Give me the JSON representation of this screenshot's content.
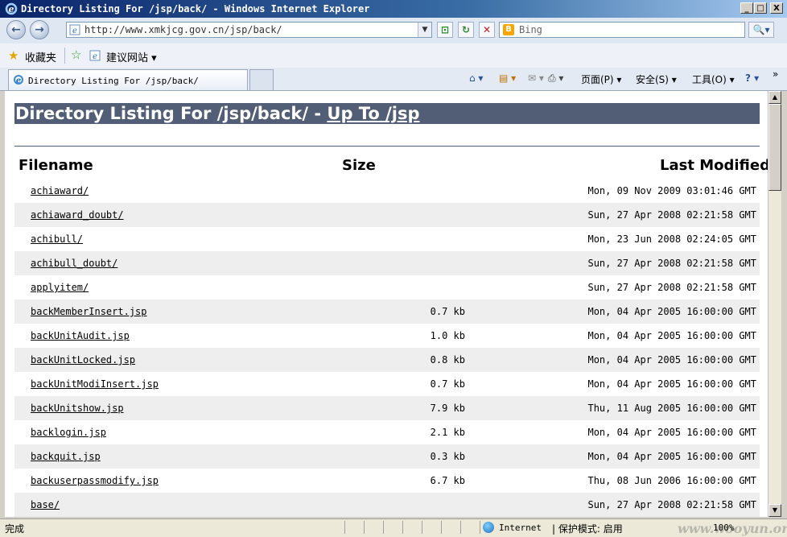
{
  "window": {
    "title": "Directory Listing For /jsp/back/ - Windows Internet Explorer",
    "minimize_label": "_",
    "maximize_label": "□",
    "close_label": "X"
  },
  "address": {
    "back_label": "←",
    "forward_label": "→",
    "url": "http://www.xmkjcg.gov.cn/jsp/back/",
    "dropdown_label": "▼",
    "compat_label": "⊡",
    "refresh_label": "↻",
    "stop_label": "✕"
  },
  "search": {
    "provider_icon": "B",
    "placeholder": "Bing",
    "button_label": "🔍▾"
  },
  "favorites": {
    "label": "收藏夹",
    "suggested_sites": "建议网站 ▾"
  },
  "tabs": [
    {
      "label": "Directory Listing For /jsp/back/"
    }
  ],
  "commands": {
    "home": "⌂ ▾",
    "feeds": "▤ ▾",
    "mail": "✉ ▾",
    "print": "⎙ ▾",
    "page": "页面(P) ▾",
    "safety": "安全(S) ▾",
    "tools": "工具(O) ▾",
    "help": "? ▾",
    "more": "»"
  },
  "page": {
    "heading_prefix": "Directory Listing For /jsp/back/ - ",
    "heading_link": "Up To /jsp",
    "col_filename": "Filename",
    "col_size": "Size",
    "col_modified": "Last Modified",
    "rows": [
      {
        "name": "achiaward/",
        "size": "",
        "modified": "Mon, 09 Nov 2009 03:01:46 GMT"
      },
      {
        "name": "achiaward_doubt/",
        "size": "",
        "modified": "Sun, 27 Apr 2008 02:21:58 GMT"
      },
      {
        "name": "achibull/",
        "size": "",
        "modified": "Mon, 23 Jun 2008 02:24:05 GMT"
      },
      {
        "name": "achibull_doubt/",
        "size": "",
        "modified": "Sun, 27 Apr 2008 02:21:58 GMT"
      },
      {
        "name": "applyitem/",
        "size": "",
        "modified": "Sun, 27 Apr 2008 02:21:58 GMT"
      },
      {
        "name": "backMemberInsert.jsp",
        "size": "0.7 kb",
        "modified": "Mon, 04 Apr 2005 16:00:00 GMT"
      },
      {
        "name": "backUnitAudit.jsp",
        "size": "1.0 kb",
        "modified": "Mon, 04 Apr 2005 16:00:00 GMT"
      },
      {
        "name": "backUnitLocked.jsp",
        "size": "0.8 kb",
        "modified": "Mon, 04 Apr 2005 16:00:00 GMT"
      },
      {
        "name": "backUnitModiInsert.jsp",
        "size": "0.7 kb",
        "modified": "Mon, 04 Apr 2005 16:00:00 GMT"
      },
      {
        "name": "backUnitshow.jsp",
        "size": "7.9 kb",
        "modified": "Thu, 11 Aug 2005 16:00:00 GMT"
      },
      {
        "name": "backlogin.jsp",
        "size": "2.1 kb",
        "modified": "Mon, 04 Apr 2005 16:00:00 GMT"
      },
      {
        "name": "backquit.jsp",
        "size": "0.3 kb",
        "modified": "Mon, 04 Apr 2005 16:00:00 GMT"
      },
      {
        "name": "backuserpassmodify.jsp",
        "size": "6.7 kb",
        "modified": "Thu, 08 Jun 2006 16:00:00 GMT"
      },
      {
        "name": "base/",
        "size": "",
        "modified": "Sun, 27 Apr 2008 02:21:58 GMT"
      }
    ]
  },
  "status": {
    "text": "完成",
    "zone": "Internet",
    "protected_mode": "| 保护模式: 启用",
    "zoom": "100%",
    "watermark": "www.wooyun.org"
  }
}
